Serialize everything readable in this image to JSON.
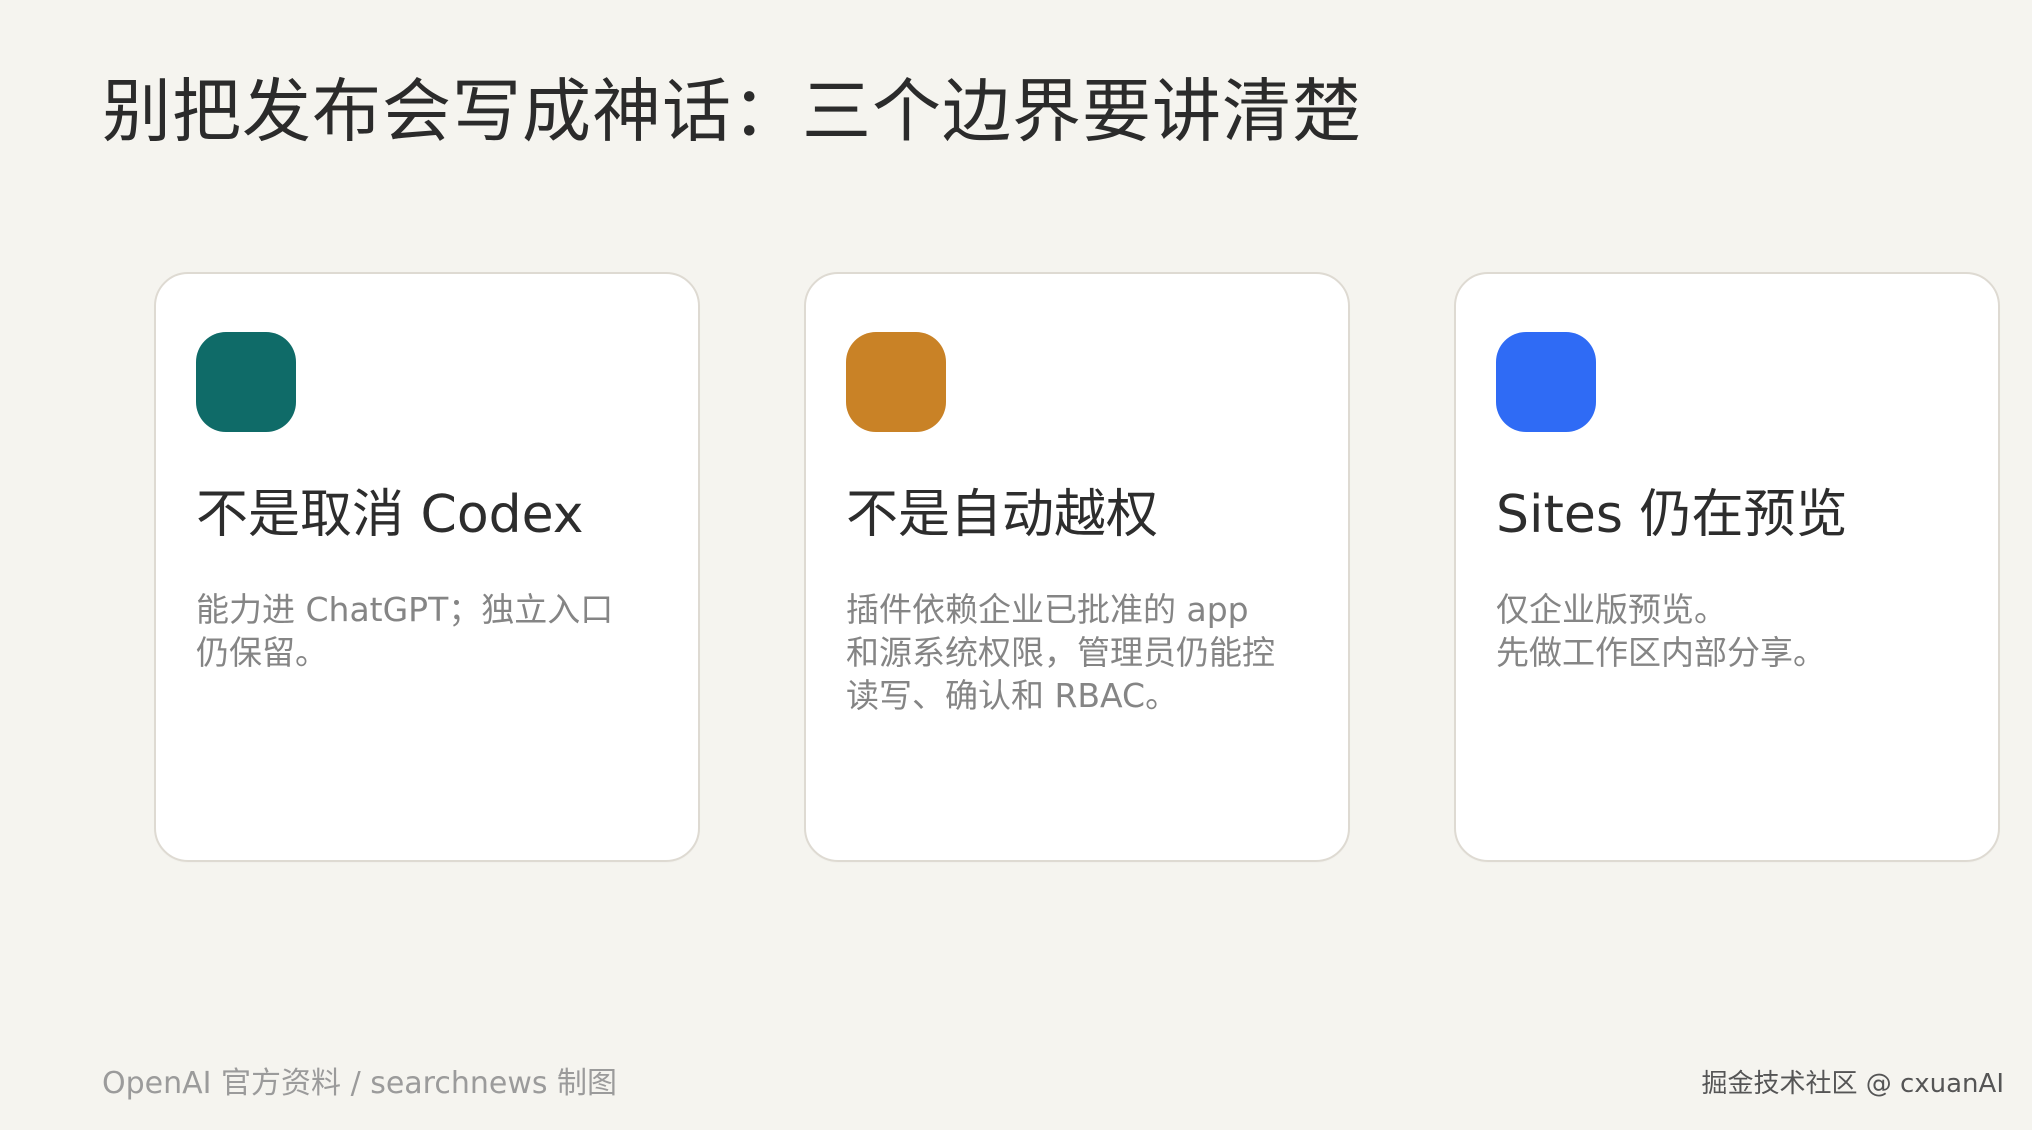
{
  "title": "别把发布会写成神话：三个边界要讲清楚",
  "cards": [
    {
      "icon": "teal-rounded-square",
      "color": "#0f6b68",
      "title": "不是取消 Codex",
      "desc": "能力进 ChatGPT；独立入口\n仍保留。"
    },
    {
      "icon": "orange-rounded-square",
      "color": "#c98226",
      "title": "不是自动越权",
      "desc": "插件依赖企业已批准的 app\n和源系统权限，管理员仍能控\n读写、确认和 RBAC。"
    },
    {
      "icon": "blue-rounded-square",
      "color": "#2f6bf5",
      "title": "Sites 仍在预览",
      "desc": "仅企业版预览。\n先做工作区内部分享。"
    }
  ],
  "footer": {
    "source": "OpenAI 官方资料 / searchnews 制图",
    "watermark": "掘金技术社区 @ cxuanAI"
  }
}
